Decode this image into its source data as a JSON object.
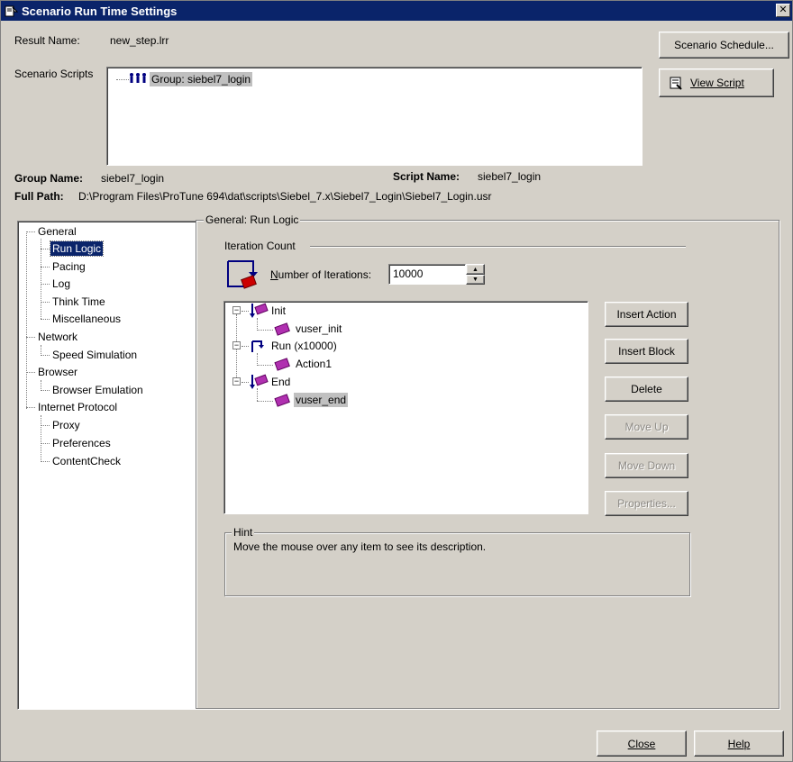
{
  "window": {
    "title": "Scenario Run Time Settings",
    "close_glyph": "✕"
  },
  "header": {
    "result_name_label": "Result Name:",
    "result_name_value": "new_step.lrr",
    "scenario_scripts_label": "Scenario Scripts",
    "scenario_schedule_button": "Scenario Schedule...",
    "view_script_button": "View Script",
    "scripts_tree_item": "Group: siebel7_login",
    "group_name_label": "Group Name:",
    "group_name_value": "siebel7_login",
    "script_name_label": "Script Name:",
    "script_name_value": "siebel7_login",
    "full_path_label": "Full Path:",
    "full_path_value": "D:\\Program Files\\ProTune 694\\dat\\scripts\\Siebel_7.x\\Siebel7_Login\\Siebel7_Login.usr"
  },
  "nav": {
    "items": [
      {
        "label": "General"
      },
      {
        "label": "Run Logic",
        "selected": true
      },
      {
        "label": "Pacing"
      },
      {
        "label": "Log"
      },
      {
        "label": "Think Time"
      },
      {
        "label": "Miscellaneous"
      },
      {
        "label": "Network"
      },
      {
        "label": "Speed Simulation"
      },
      {
        "label": "Browser"
      },
      {
        "label": "Browser Emulation"
      },
      {
        "label": "Internet Protocol"
      },
      {
        "label": "Proxy"
      },
      {
        "label": "Preferences"
      },
      {
        "label": "ContentCheck"
      }
    ]
  },
  "panel": {
    "title": "General: Run Logic",
    "iteration_count_label": "Iteration Count",
    "iterations_label_prefix": "N",
    "iterations_label_rest": "umber of Iterations:",
    "iterations_value": "10000",
    "tree": {
      "init": "Init",
      "vuser_init": "vuser_init",
      "run": "Run (x10000)",
      "action1": "Action1",
      "end": "End",
      "vuser_end": "vuser_end"
    },
    "buttons": {
      "insert_action": "Insert Action",
      "insert_block": "Insert Block",
      "delete": "Delete",
      "move_up": "Move Up",
      "move_down": "Move Down",
      "properties": "Properties..."
    },
    "hint_label": "Hint",
    "hint_text": "Move the mouse over any item to see its description."
  },
  "footer": {
    "close_button": "Close",
    "help_button": "Help"
  }
}
